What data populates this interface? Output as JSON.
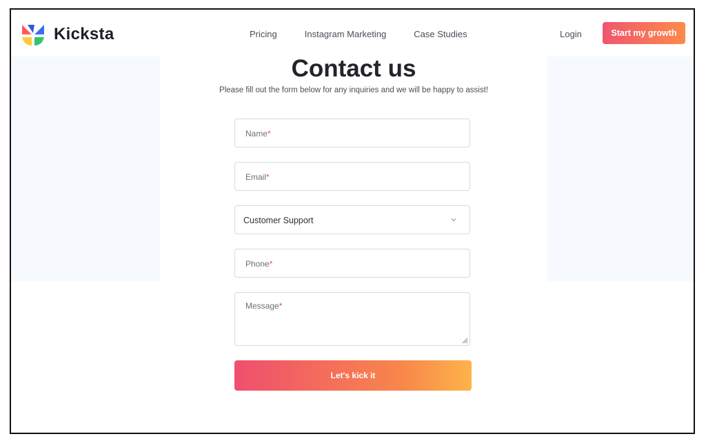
{
  "brand": {
    "name": "Kicksta"
  },
  "nav": {
    "items": [
      {
        "label": "Pricing"
      },
      {
        "label": "Instagram Marketing"
      },
      {
        "label": "Case Studies"
      }
    ],
    "login": "Login",
    "cta": "Start my growth"
  },
  "contact": {
    "title": "Contact us",
    "subtitle": "Please fill out the form below for any inquiries and we will be happy to assist!",
    "fields": {
      "name": {
        "label": "Name",
        "required": "*"
      },
      "email": {
        "label": "Email",
        "required": "*"
      },
      "topic": {
        "value": "Customer Support"
      },
      "phone": {
        "label": "Phone",
        "required": "*"
      },
      "message": {
        "label": "Message",
        "required": "*"
      }
    },
    "submit": "Let's kick it"
  },
  "colors": {
    "cta_start": "#f0566f",
    "cta_end": "#fd8a4a",
    "required": "#e4506e",
    "page_bg": "#f6f9fd"
  },
  "icons": {
    "logo": "kicksta-pinwheel-logo",
    "select": "chevron-down-icon",
    "resize": "resize-handle-icon"
  }
}
